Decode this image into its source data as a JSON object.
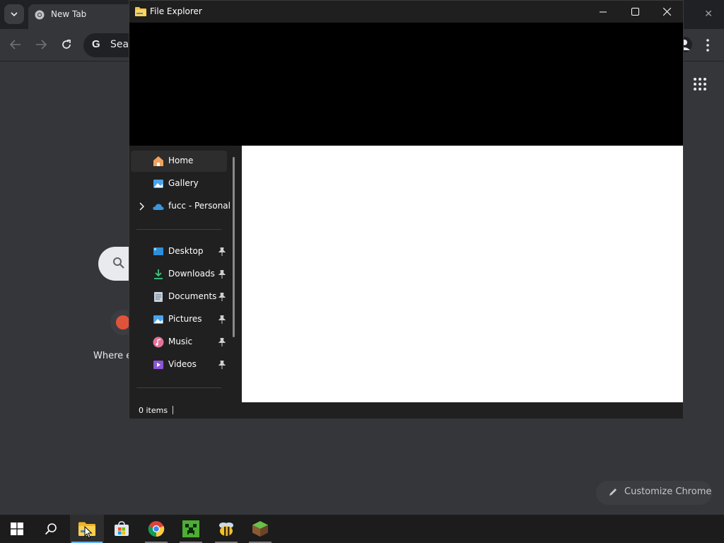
{
  "chrome": {
    "tab_title": "New Tab",
    "omnibox_text": "Sear",
    "shortcut_label": "Where e",
    "customize_label": "Customize Chrome"
  },
  "explorer": {
    "title": "File Explorer",
    "nav": {
      "home": "Home",
      "gallery": "Gallery",
      "onedrive": "fucc - Personal",
      "desktop": "Desktop",
      "downloads": "Downloads",
      "documents": "Documents",
      "pictures": "Pictures",
      "music": "Music",
      "videos": "Videos"
    },
    "status": "0 items"
  },
  "taskbar": {
    "apps": [
      "start-icon",
      "search-icon",
      "file-explorer-icon",
      "microsoft-store-icon",
      "chrome-icon",
      "minecraft-icon",
      "bee-app-icon",
      "minecraft-launcher-icon"
    ]
  },
  "colors": {
    "accent": "#5fb4f5",
    "chrome_bg": "#35363a",
    "explorer_bg": "#202020"
  }
}
